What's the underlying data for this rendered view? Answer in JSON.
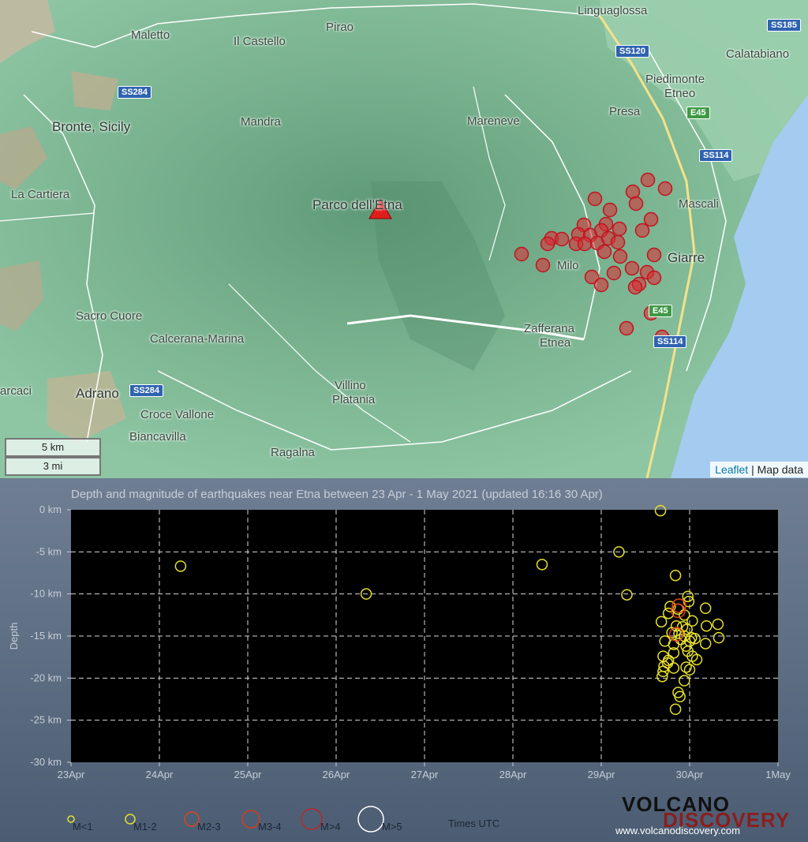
{
  "map": {
    "places": [
      {
        "name": "Maletto"
      },
      {
        "name": "Il Castello"
      },
      {
        "name": "Pirao"
      },
      {
        "name": "Linguaglossa"
      },
      {
        "name": "Calatabiano"
      },
      {
        "name": "Piedimonte"
      },
      {
        "name": "Etneo"
      },
      {
        "name": "Presa"
      },
      {
        "name": "Bronte, Sicily"
      },
      {
        "name": "Mandra"
      },
      {
        "name": "Mareneve"
      },
      {
        "name": "La Cartiera"
      },
      {
        "name": "Parco dell'Etna"
      },
      {
        "name": "Mascali"
      },
      {
        "name": "Giarre"
      },
      {
        "name": "Milo"
      },
      {
        "name": "Sacro Cuore"
      },
      {
        "name": "Calcerana-Marina"
      },
      {
        "name": "Zafferana"
      },
      {
        "name": "Etnea"
      },
      {
        "name": "Adrano"
      },
      {
        "name": "Villino"
      },
      {
        "name": "Platania"
      },
      {
        "name": "arcaci"
      },
      {
        "name": "Croce Vallone"
      },
      {
        "name": "Biancavilla"
      },
      {
        "name": "Ragalna"
      }
    ],
    "roads": [
      "SS185",
      "SS120",
      "SS284",
      "E45",
      "SS114",
      "SS284",
      "E45",
      "SS114"
    ],
    "scale": {
      "km": "5 km",
      "mi": "3 mi"
    },
    "attribution": {
      "leaflet": "Leaflet",
      "rest": "| Map data"
    }
  },
  "chart_data": {
    "type": "scatter",
    "title": "Depth and magnitude of earthquakes near Etna between 23 Apr - 1 May 2021 (updated 16:16 30 Apr)",
    "ylabel": "Depth",
    "xlabel": "",
    "x_ticks": [
      "23Apr",
      "24Apr",
      "25Apr",
      "26Apr",
      "27Apr",
      "28Apr",
      "29Apr",
      "30Apr",
      "1May"
    ],
    "y_ticks": [
      "0 km",
      "-5 km",
      "-10 km",
      "-15 km",
      "-20 km",
      "-25 km",
      "-30 km"
    ],
    "xlim": [
      0,
      8
    ],
    "ylim": [
      -30,
      0
    ],
    "grid": true,
    "series": [
      {
        "name": "M1-2",
        "color": "#e6e02a",
        "points": [
          [
            1.24,
            -6.7
          ],
          [
            3.34,
            -10.0
          ],
          [
            5.33,
            -6.5
          ],
          [
            6.2,
            -5.0
          ],
          [
            6.29,
            -10.1
          ],
          [
            6.67,
            -0.1
          ],
          [
            6.84,
            -7.8
          ],
          [
            6.98,
            -10.3
          ],
          [
            6.99,
            -10.9
          ],
          [
            6.78,
            -11.5
          ],
          [
            6.87,
            -11.8
          ],
          [
            6.94,
            -12.5
          ],
          [
            6.76,
            -12.3
          ],
          [
            7.18,
            -11.7
          ],
          [
            6.68,
            -13.3
          ],
          [
            6.85,
            -13.8
          ],
          [
            6.97,
            -14.2
          ],
          [
            7.03,
            -13.2
          ],
          [
            7.19,
            -13.8
          ],
          [
            7.32,
            -13.6
          ],
          [
            6.8,
            -14.6
          ],
          [
            6.88,
            -14.7
          ],
          [
            6.94,
            -15.0
          ],
          [
            6.9,
            -15.4
          ],
          [
            7.02,
            -15.2
          ],
          [
            7.06,
            -15.3
          ],
          [
            6.72,
            -15.6
          ],
          [
            6.82,
            -16.0
          ],
          [
            6.96,
            -16.2
          ],
          [
            7.18,
            -15.9
          ],
          [
            7.33,
            -15.2
          ],
          [
            6.82,
            -17.0
          ],
          [
            7.03,
            -17.4
          ],
          [
            7.08,
            -17.8
          ],
          [
            6.7,
            -17.4
          ],
          [
            6.76,
            -17.9
          ],
          [
            6.71,
            -18.6
          ],
          [
            6.82,
            -18.8
          ],
          [
            6.96,
            -18.7
          ],
          [
            6.7,
            -19.2
          ],
          [
            6.69,
            -19.8
          ],
          [
            7.0,
            -19.0
          ],
          [
            6.94,
            -20.3
          ],
          [
            6.87,
            -21.7
          ],
          [
            6.89,
            -22.2
          ],
          [
            6.84,
            -23.7
          ],
          [
            6.75,
            -18.2
          ],
          [
            6.98,
            -16.8
          ],
          [
            7.0,
            -15.6
          ],
          [
            6.92,
            -13.9
          ]
        ]
      },
      {
        "name": "M2-3",
        "color": "#e0411f",
        "points": [
          [
            6.88,
            -11.4
          ],
          [
            6.87,
            -12.0
          ],
          [
            6.85,
            -14.8
          ]
        ]
      }
    ],
    "legend": [
      {
        "label": "M<1",
        "r": 4,
        "color": "#e6e02a"
      },
      {
        "label": "M1-2",
        "r": 6,
        "color": "#e6e02a"
      },
      {
        "label": "M2-3",
        "r": 9,
        "color": "#e0411f"
      },
      {
        "label": "M3-4",
        "r": 11,
        "color": "#d83a1c"
      },
      {
        "label": "M>4",
        "r": 13,
        "color": "#b5282a"
      },
      {
        "label": "M>5",
        "r": 16,
        "color": "#ffffff"
      }
    ],
    "legend_placement": "bottom",
    "timezone_note": "Times UTC"
  },
  "logo": {
    "line1": "VOLCANO",
    "line2": "DISCOVERY",
    "url": "www.volcanodiscovery.com"
  }
}
